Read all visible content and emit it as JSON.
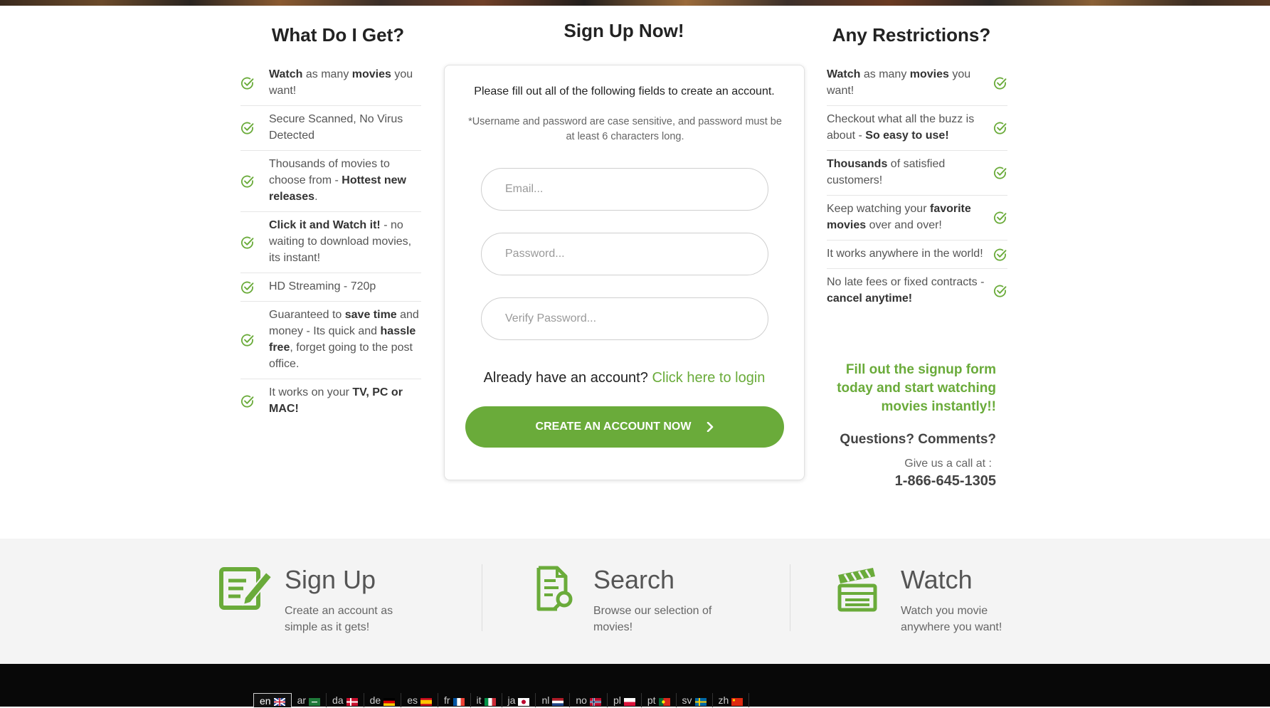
{
  "left_column": {
    "title": "What Do I Get?",
    "items": [
      [
        {
          "t": "Watch",
          "b": true
        },
        {
          "t": " as many "
        },
        {
          "t": "movies",
          "b": true
        },
        {
          "t": " you want!"
        }
      ],
      [
        {
          "t": "Secure Scanned, No Virus Detected"
        }
      ],
      [
        {
          "t": "Thousands of movies to choose from - "
        },
        {
          "t": "Hottest new releases",
          "b": true
        },
        {
          "t": "."
        }
      ],
      [
        {
          "t": "Click it and Watch it!",
          "b": true
        },
        {
          "t": " - no waiting to download movies, its instant!"
        }
      ],
      [
        {
          "t": "HD Streaming - 720p"
        }
      ],
      [
        {
          "t": "Guaranteed to "
        },
        {
          "t": "save time",
          "b": true
        },
        {
          "t": " and money - Its quick and "
        },
        {
          "t": "hassle free",
          "b": true
        },
        {
          "t": ", forget going to the post office."
        }
      ],
      [
        {
          "t": "It works on your "
        },
        {
          "t": "TV, PC or MAC!",
          "b": true
        }
      ]
    ]
  },
  "signup_form": {
    "title": "Sign Up Now!",
    "intro": "Please fill out all of the following fields to create an account.",
    "note": "*Username and password are case sensitive, and password must be at least 6 characters long.",
    "email_placeholder": "Email...",
    "password_placeholder": "Password...",
    "verify_placeholder": "Verify Password...",
    "login_prompt": "Already have an account?",
    "login_link": "Click here to login",
    "submit_label": "CREATE AN ACCOUNT NOW"
  },
  "right_column": {
    "title": "Any Restrictions?",
    "items": [
      [
        {
          "t": "Watch",
          "b": true
        },
        {
          "t": " as many "
        },
        {
          "t": "movies",
          "b": true
        },
        {
          "t": " you want!"
        }
      ],
      [
        {
          "t": "Checkout what all the buzz is about - "
        },
        {
          "t": "So easy to use!",
          "b": true
        }
      ],
      [
        {
          "t": "Thousands",
          "b": true
        },
        {
          "t": " of satisfied customers!"
        }
      ],
      [
        {
          "t": "Keep watching your "
        },
        {
          "t": "favorite movies",
          "b": true
        },
        {
          "t": " over and over!"
        }
      ],
      [
        {
          "t": "It works anywhere in the world!"
        }
      ],
      [
        {
          "t": "No late fees or fixed contracts - "
        },
        {
          "t": "cancel anytime!",
          "b": true
        }
      ]
    ],
    "cta": "Fill out the signup form today and start watching movies instantly!!",
    "questions": "Questions? Comments?",
    "call_label": "Give us a call at :",
    "phone": "1-866-645-1305"
  },
  "steps": [
    {
      "title": "Sign Up",
      "desc": "Create an account as simple as it gets!",
      "icon": "signup-pencil-icon"
    },
    {
      "title": "Search",
      "desc": "Browse our selection of movies!",
      "icon": "document-search-icon"
    },
    {
      "title": "Watch",
      "desc": "Watch you movie anywhere you want!",
      "icon": "clapperboard-icon"
    }
  ],
  "languages": [
    "en",
    "ar",
    "da",
    "de",
    "es",
    "fr",
    "it",
    "ja",
    "nl",
    "no",
    "pl",
    "pt",
    "sv",
    "zh"
  ],
  "active_language": "en",
  "colors": {
    "accent": "#6aab3a",
    "footer": "#080808",
    "steps_bg": "#f4f4f4"
  }
}
